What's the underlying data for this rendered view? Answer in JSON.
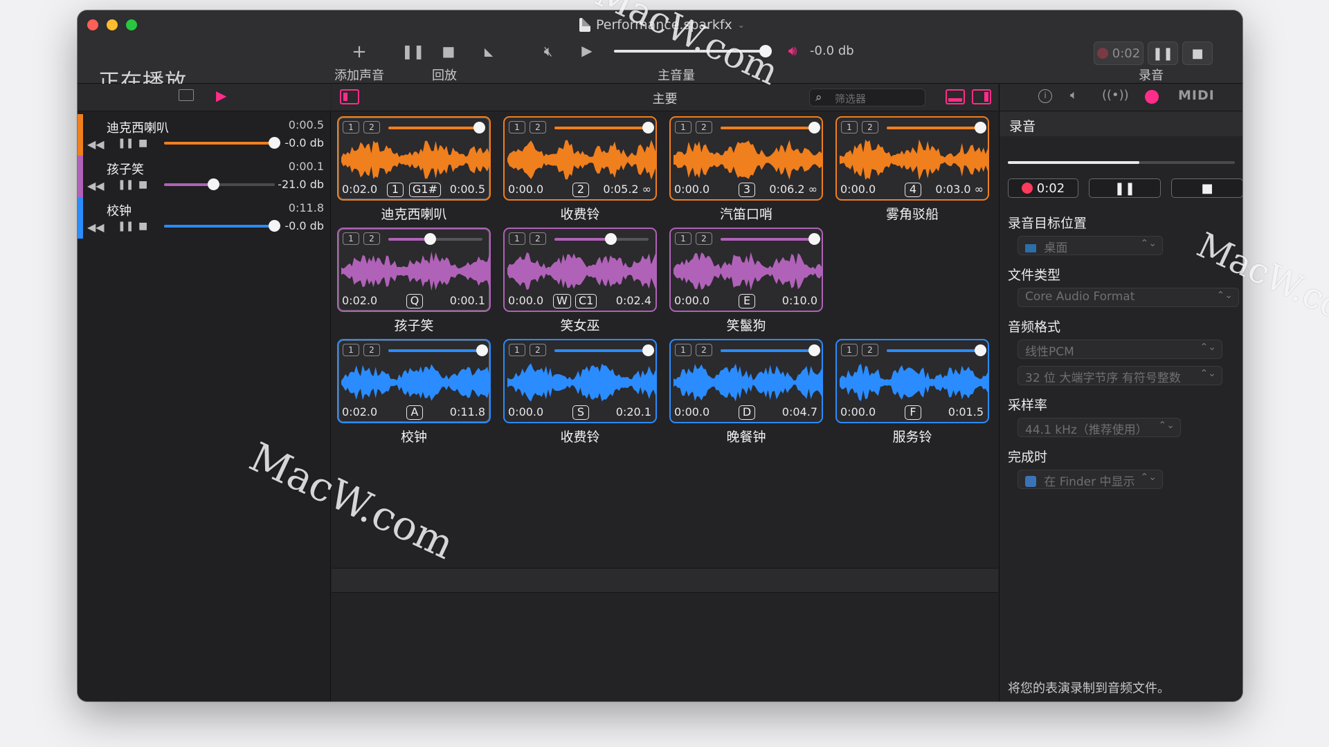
{
  "window": {
    "doc_title": "Performance.sparkfx",
    "title": "正在播放"
  },
  "toolbar": {
    "add_sound_label": "添加声音",
    "playback_label": "回放",
    "master_volume_label": "主音量",
    "master_volume_db": "-0.0 db",
    "record_label": "录音",
    "record_time": "0:02"
  },
  "now_playing": [
    {
      "name": "迪克西喇叭",
      "time": "0:00.5",
      "db": "-0.0 db",
      "level": 1.0,
      "color": "#f07f1e"
    },
    {
      "name": "孩子笑",
      "time": "0:00.1",
      "db": "-21.0 db",
      "level": 0.45,
      "color": "#b062b8"
    },
    {
      "name": "校钟",
      "time": "0:11.8",
      "db": "-0.0 db",
      "level": 1.0,
      "color": "#2a8cff"
    }
  ],
  "center": {
    "title": "主要",
    "filter_placeholder": "筛选器"
  },
  "sounds": [
    {
      "name": "迪克西喇叭",
      "start": "0:02.0",
      "num": "1",
      "key": "G1#",
      "end": "0:00.5",
      "color": "#f07f1e",
      "level": 0.97
    },
    {
      "name": "收费铃",
      "start": "0:00.0",
      "key": "2",
      "end": "0:05.2 ∞",
      "color": "#f07f1e",
      "level": 1.0
    },
    {
      "name": "汽笛口哨",
      "start": "0:00.0",
      "key": "3",
      "end": "0:06.2 ∞",
      "color": "#f07f1e",
      "level": 1.0
    },
    {
      "name": "雾角驳船",
      "start": "0:00.0",
      "key": "4",
      "end": "0:03.0 ∞",
      "color": "#f07f1e",
      "level": 1.0
    },
    {
      "name": "孩子笑",
      "start": "0:02.0",
      "key": "Q",
      "end": "0:00.1",
      "color": "#b062b8",
      "level": 0.45
    },
    {
      "name": "笑女巫",
      "start": "0:00.0",
      "num": "W",
      "key": "C1",
      "end": "0:02.4",
      "color": "#b062b8",
      "level": 0.6
    },
    {
      "name": "笑鬣狗",
      "start": "0:00.0",
      "key": "E",
      "end": "0:10.0",
      "color": "#b062b8",
      "level": 1.0
    },
    {
      "name": "校钟",
      "start": "0:02.0",
      "key": "A",
      "end": "0:11.8",
      "color": "#2a8cff",
      "level": 1.0
    },
    {
      "name": "收费铃",
      "start": "0:00.0",
      "key": "S",
      "end": "0:20.1",
      "color": "#2a8cff",
      "level": 1.0
    },
    {
      "name": "晚餐钟",
      "start": "0:00.0",
      "key": "D",
      "end": "0:04.7",
      "color": "#2a8cff",
      "level": 1.0
    },
    {
      "name": "服务铃",
      "start": "0:00.0",
      "key": "F",
      "end": "0:01.5",
      "color": "#2a8cff",
      "level": 1.0
    }
  ],
  "badges": [
    "1",
    "2"
  ],
  "right_panel": {
    "heading": "录音",
    "record_time": "0:02",
    "dest_label": "录音目标位置",
    "dest_value": "桌面",
    "file_type_label": "文件类型",
    "file_type_value": "Core Audio Format",
    "audio_format_label": "音频格式",
    "audio_format_value": "线性PCM",
    "bit_depth_value": "32 位 大端字节序 有符号整数",
    "sample_rate_label": "采样率",
    "sample_rate_value": "44.1 kHz（推荐使用）",
    "on_finish_label": "完成时",
    "on_finish_value": "在 Finder 中显示",
    "footer": "将您的表演录制到音频文件。",
    "tab_midi": "MIDI",
    "progress": 0.58
  },
  "watermark": "MacW.com",
  "colors": {
    "orange": "#f07f1e",
    "purple": "#b062b8",
    "blue": "#2a8cff",
    "record": "#ff3b5c",
    "accent_pink": "#ff2d8a"
  }
}
